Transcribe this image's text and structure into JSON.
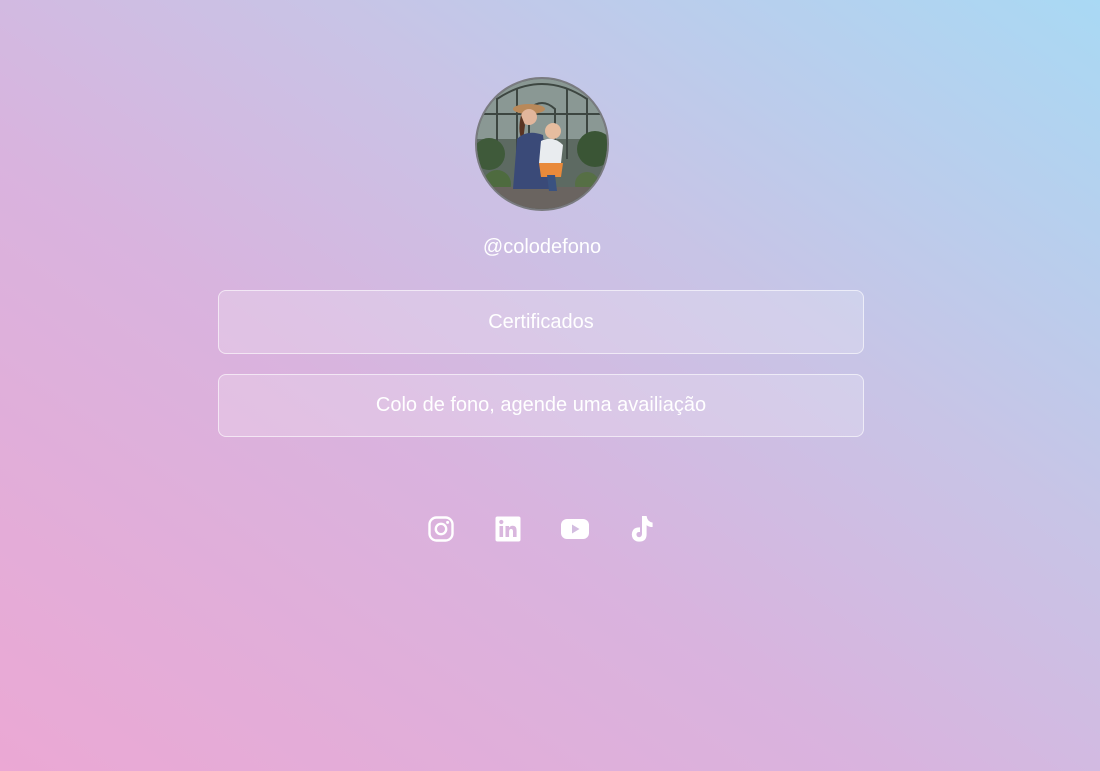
{
  "profile": {
    "handle": "@colodefono",
    "avatar_alt": "profile-photo"
  },
  "links": [
    {
      "label": "Certificados"
    },
    {
      "label": "Colo de fono, agende uma availiação"
    }
  ],
  "socials": [
    {
      "icon": "instagram-icon"
    },
    {
      "icon": "linkedin-icon"
    },
    {
      "icon": "youtube-icon"
    },
    {
      "icon": "tiktok-icon"
    }
  ],
  "colors": {
    "gradient_start": "#eba8d4",
    "gradient_end": "#a9d9f4",
    "text": "#ffffff"
  }
}
